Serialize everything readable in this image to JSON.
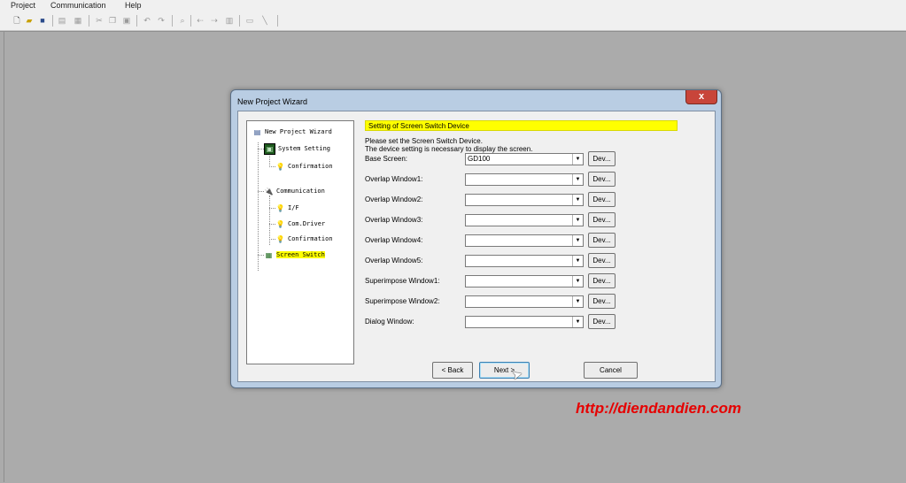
{
  "menu": {
    "items": [
      "Project",
      "Communication",
      "Help"
    ]
  },
  "toolbar": {
    "icons": [
      "new-icon",
      "open-icon",
      "save-icon",
      "print-icon",
      "print-preview-icon",
      "cut-icon",
      "copy-icon",
      "paste-icon",
      "undo-icon",
      "redo-icon",
      "find-icon",
      "back-icon",
      "forward-icon",
      "screen-list-icon",
      "window-icon",
      "pen-icon"
    ]
  },
  "wizard": {
    "title": "New Project Wizard",
    "close_label": "x",
    "tree": {
      "root": "New Project Wizard",
      "system_setting": "System Setting",
      "confirmation_1": "Confirmation",
      "communication": "Communication",
      "if": "I/F",
      "com_driver": "Com.Driver",
      "confirmation_2": "Confirmation",
      "screen_switch": "Screen Switch"
    },
    "header": "Setting of Screen Switch Device",
    "description_line1": "Please set the Screen Switch Device.",
    "description_line2": "The device setting is necessary to display the screen.",
    "fields": [
      {
        "label": "Base Screen:",
        "value": "GD100",
        "button": "Dev..."
      },
      {
        "label": "Overlap Window1:",
        "value": "",
        "button": "Dev..."
      },
      {
        "label": "Overlap Window2:",
        "value": "",
        "button": "Dev..."
      },
      {
        "label": "Overlap Window3:",
        "value": "",
        "button": "Dev..."
      },
      {
        "label": "Overlap Window4:",
        "value": "",
        "button": "Dev..."
      },
      {
        "label": "Overlap Window5:",
        "value": "",
        "button": "Dev..."
      },
      {
        "label": "Superimpose Window1:",
        "value": "",
        "button": "Dev..."
      },
      {
        "label": "Superimpose Window2:",
        "value": "",
        "button": "Dev..."
      },
      {
        "label": "Dialog Window:",
        "value": "",
        "button": "Dev..."
      }
    ],
    "buttons": {
      "back": "< Back",
      "next": "Next >",
      "cancel": "Cancel"
    }
  },
  "watermark": "http://diendandien.com",
  "colors": {
    "highlight": "#ffff00",
    "watermark": "#e60000",
    "desktop": "#ababab",
    "title_frame": "#b9cde3",
    "close_button": "#c8453a"
  }
}
